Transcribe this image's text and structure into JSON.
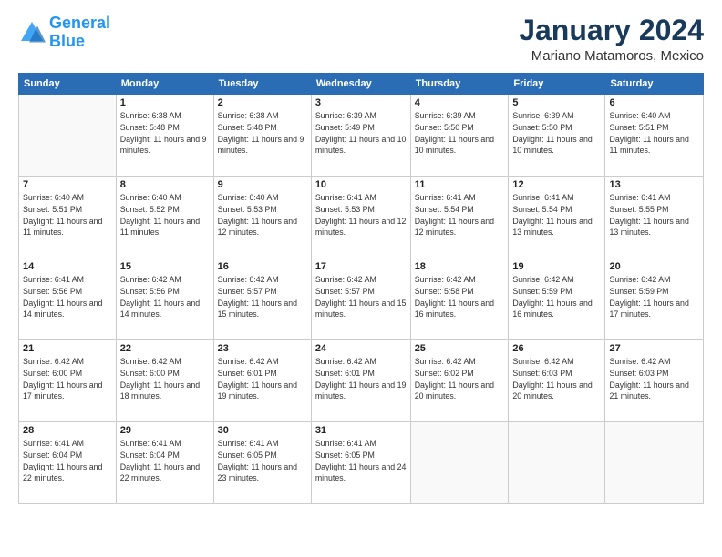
{
  "logo": {
    "text_general": "General",
    "text_blue": "Blue"
  },
  "header": {
    "month_title": "January 2024",
    "location": "Mariano Matamoros, Mexico"
  },
  "weekdays": [
    "Sunday",
    "Monday",
    "Tuesday",
    "Wednesday",
    "Thursday",
    "Friday",
    "Saturday"
  ],
  "weeks": [
    [
      {
        "day": "",
        "sunrise": "",
        "sunset": "",
        "daylight": ""
      },
      {
        "day": "1",
        "sunrise": "Sunrise: 6:38 AM",
        "sunset": "Sunset: 5:48 PM",
        "daylight": "Daylight: 11 hours and 9 minutes."
      },
      {
        "day": "2",
        "sunrise": "Sunrise: 6:38 AM",
        "sunset": "Sunset: 5:48 PM",
        "daylight": "Daylight: 11 hours and 9 minutes."
      },
      {
        "day": "3",
        "sunrise": "Sunrise: 6:39 AM",
        "sunset": "Sunset: 5:49 PM",
        "daylight": "Daylight: 11 hours and 10 minutes."
      },
      {
        "day": "4",
        "sunrise": "Sunrise: 6:39 AM",
        "sunset": "Sunset: 5:50 PM",
        "daylight": "Daylight: 11 hours and 10 minutes."
      },
      {
        "day": "5",
        "sunrise": "Sunrise: 6:39 AM",
        "sunset": "Sunset: 5:50 PM",
        "daylight": "Daylight: 11 hours and 10 minutes."
      },
      {
        "day": "6",
        "sunrise": "Sunrise: 6:40 AM",
        "sunset": "Sunset: 5:51 PM",
        "daylight": "Daylight: 11 hours and 11 minutes."
      }
    ],
    [
      {
        "day": "7",
        "sunrise": "Sunrise: 6:40 AM",
        "sunset": "Sunset: 5:51 PM",
        "daylight": "Daylight: 11 hours and 11 minutes."
      },
      {
        "day": "8",
        "sunrise": "Sunrise: 6:40 AM",
        "sunset": "Sunset: 5:52 PM",
        "daylight": "Daylight: 11 hours and 11 minutes."
      },
      {
        "day": "9",
        "sunrise": "Sunrise: 6:40 AM",
        "sunset": "Sunset: 5:53 PM",
        "daylight": "Daylight: 11 hours and 12 minutes."
      },
      {
        "day": "10",
        "sunrise": "Sunrise: 6:41 AM",
        "sunset": "Sunset: 5:53 PM",
        "daylight": "Daylight: 11 hours and 12 minutes."
      },
      {
        "day": "11",
        "sunrise": "Sunrise: 6:41 AM",
        "sunset": "Sunset: 5:54 PM",
        "daylight": "Daylight: 11 hours and 12 minutes."
      },
      {
        "day": "12",
        "sunrise": "Sunrise: 6:41 AM",
        "sunset": "Sunset: 5:54 PM",
        "daylight": "Daylight: 11 hours and 13 minutes."
      },
      {
        "day": "13",
        "sunrise": "Sunrise: 6:41 AM",
        "sunset": "Sunset: 5:55 PM",
        "daylight": "Daylight: 11 hours and 13 minutes."
      }
    ],
    [
      {
        "day": "14",
        "sunrise": "Sunrise: 6:41 AM",
        "sunset": "Sunset: 5:56 PM",
        "daylight": "Daylight: 11 hours and 14 minutes."
      },
      {
        "day": "15",
        "sunrise": "Sunrise: 6:42 AM",
        "sunset": "Sunset: 5:56 PM",
        "daylight": "Daylight: 11 hours and 14 minutes."
      },
      {
        "day": "16",
        "sunrise": "Sunrise: 6:42 AM",
        "sunset": "Sunset: 5:57 PM",
        "daylight": "Daylight: 11 hours and 15 minutes."
      },
      {
        "day": "17",
        "sunrise": "Sunrise: 6:42 AM",
        "sunset": "Sunset: 5:57 PM",
        "daylight": "Daylight: 11 hours and 15 minutes."
      },
      {
        "day": "18",
        "sunrise": "Sunrise: 6:42 AM",
        "sunset": "Sunset: 5:58 PM",
        "daylight": "Daylight: 11 hours and 16 minutes."
      },
      {
        "day": "19",
        "sunrise": "Sunrise: 6:42 AM",
        "sunset": "Sunset: 5:59 PM",
        "daylight": "Daylight: 11 hours and 16 minutes."
      },
      {
        "day": "20",
        "sunrise": "Sunrise: 6:42 AM",
        "sunset": "Sunset: 5:59 PM",
        "daylight": "Daylight: 11 hours and 17 minutes."
      }
    ],
    [
      {
        "day": "21",
        "sunrise": "Sunrise: 6:42 AM",
        "sunset": "Sunset: 6:00 PM",
        "daylight": "Daylight: 11 hours and 17 minutes."
      },
      {
        "day": "22",
        "sunrise": "Sunrise: 6:42 AM",
        "sunset": "Sunset: 6:00 PM",
        "daylight": "Daylight: 11 hours and 18 minutes."
      },
      {
        "day": "23",
        "sunrise": "Sunrise: 6:42 AM",
        "sunset": "Sunset: 6:01 PM",
        "daylight": "Daylight: 11 hours and 19 minutes."
      },
      {
        "day": "24",
        "sunrise": "Sunrise: 6:42 AM",
        "sunset": "Sunset: 6:01 PM",
        "daylight": "Daylight: 11 hours and 19 minutes."
      },
      {
        "day": "25",
        "sunrise": "Sunrise: 6:42 AM",
        "sunset": "Sunset: 6:02 PM",
        "daylight": "Daylight: 11 hours and 20 minutes."
      },
      {
        "day": "26",
        "sunrise": "Sunrise: 6:42 AM",
        "sunset": "Sunset: 6:03 PM",
        "daylight": "Daylight: 11 hours and 20 minutes."
      },
      {
        "day": "27",
        "sunrise": "Sunrise: 6:42 AM",
        "sunset": "Sunset: 6:03 PM",
        "daylight": "Daylight: 11 hours and 21 minutes."
      }
    ],
    [
      {
        "day": "28",
        "sunrise": "Sunrise: 6:41 AM",
        "sunset": "Sunset: 6:04 PM",
        "daylight": "Daylight: 11 hours and 22 minutes."
      },
      {
        "day": "29",
        "sunrise": "Sunrise: 6:41 AM",
        "sunset": "Sunset: 6:04 PM",
        "daylight": "Daylight: 11 hours and 22 minutes."
      },
      {
        "day": "30",
        "sunrise": "Sunrise: 6:41 AM",
        "sunset": "Sunset: 6:05 PM",
        "daylight": "Daylight: 11 hours and 23 minutes."
      },
      {
        "day": "31",
        "sunrise": "Sunrise: 6:41 AM",
        "sunset": "Sunset: 6:05 PM",
        "daylight": "Daylight: 11 hours and 24 minutes."
      },
      {
        "day": "",
        "sunrise": "",
        "sunset": "",
        "daylight": ""
      },
      {
        "day": "",
        "sunrise": "",
        "sunset": "",
        "daylight": ""
      },
      {
        "day": "",
        "sunrise": "",
        "sunset": "",
        "daylight": ""
      }
    ]
  ]
}
